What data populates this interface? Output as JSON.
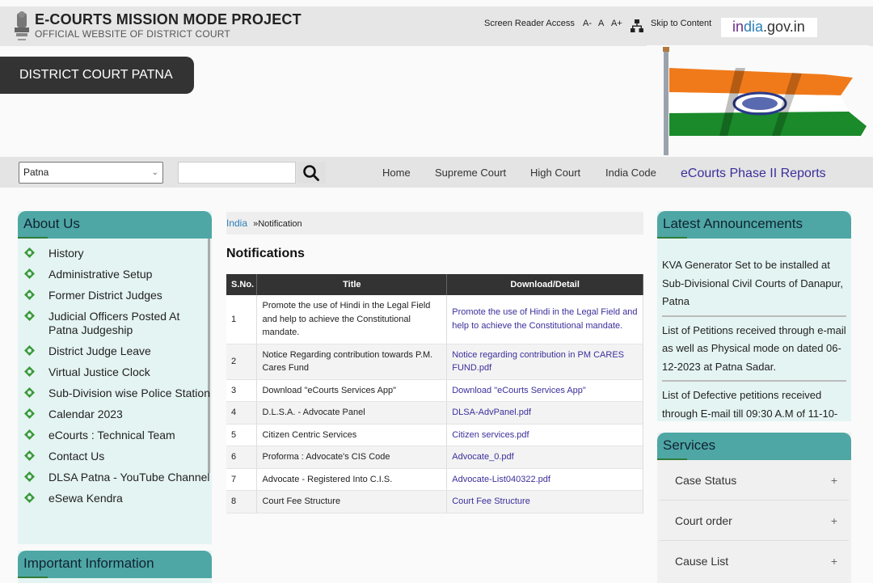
{
  "header": {
    "title": "E-COURTS MISSION MODE PROJECT",
    "subtitle": "OFFICIAL WEBSITE OF DISTRICT COURT",
    "screen_reader": "Screen Reader Access",
    "font_decrease": "A-",
    "font_normal": "A",
    "font_increase": "A+",
    "skip_to_content": "Skip to Content",
    "india_gov": {
      "part1": "in",
      "part2": "dia",
      "part3": ".gov.in"
    }
  },
  "banner": {
    "district_name": "DISTRICT COURT PATNA"
  },
  "navbar": {
    "district_select": "Patna",
    "search_placeholder": "",
    "links": [
      "Home",
      "Supreme Court",
      "High Court",
      "India Code",
      "eCourts Phase II Reports"
    ]
  },
  "about": {
    "heading": "About Us",
    "items": [
      "History",
      "Administrative Setup",
      "Former District Judges",
      "Judicial Officers Posted At Patna Judgeship",
      "District Judge Leave",
      "Virtual Justice Clock",
      "Sub-Division wise Police Station",
      "Calendar 2023",
      "eCourts : Technical Team",
      "Contact Us",
      "DLSA Patna - YouTube Channel",
      "eSewa Kendra"
    ]
  },
  "important": {
    "heading": "Important Information"
  },
  "breadcrumb": {
    "home": "India",
    "separator": "»",
    "current": "Notification"
  },
  "main": {
    "title": "Notifications",
    "columns": [
      "S.No.",
      "Title",
      "Download/Detail"
    ],
    "rows": [
      {
        "sno": "1",
        "title": "Promote the use of Hindi in the Legal Field and help to achieve the Constitutional mandate.",
        "link": "Promote the use of Hindi in the Legal Field and help to achieve the Constitutional mandate."
      },
      {
        "sno": "2",
        "title": "Notice Regarding contribution towards P.M. Cares Fund",
        "link": "Notice regarding contribution in PM CARES FUND.pdf"
      },
      {
        "sno": "3",
        "title": "Download \"eCourts Services App\"",
        "link": "Download \"eCourts Services App\""
      },
      {
        "sno": "4",
        "title": "D.L.S.A. - Advocate Panel",
        "link": "DLSA-AdvPanel.pdf"
      },
      {
        "sno": "5",
        "title": "Citizen Centric Services",
        "link": "Citizen services.pdf"
      },
      {
        "sno": "6",
        "title": "Proforma : Advocate's CIS Code",
        "link": "Advocate_0.pdf"
      },
      {
        "sno": "7",
        "title": "Advocate - Registered Into C.I.S.",
        "link": "Advocate-List040322.pdf"
      },
      {
        "sno": "8",
        "title": "Court Fee Structure",
        "link": "Court Fee Structure"
      }
    ]
  },
  "announcements": {
    "heading": "Latest Announcements",
    "items": [
      "KVA Generator Set to be installed at Sub-Divisional Civil Courts of Danapur, Patna",
      "List of Petitions received through e-mail as well as Physical mode on dated 06-12-2023 at Patna Sadar.",
      "List of Defective petitions received through E-mail till 09:30 A.M of 11-10-"
    ]
  },
  "services": {
    "heading": "Services",
    "items": [
      "Case Status",
      "Court order",
      "Cause List"
    ],
    "expand_symbol": "+"
  }
}
